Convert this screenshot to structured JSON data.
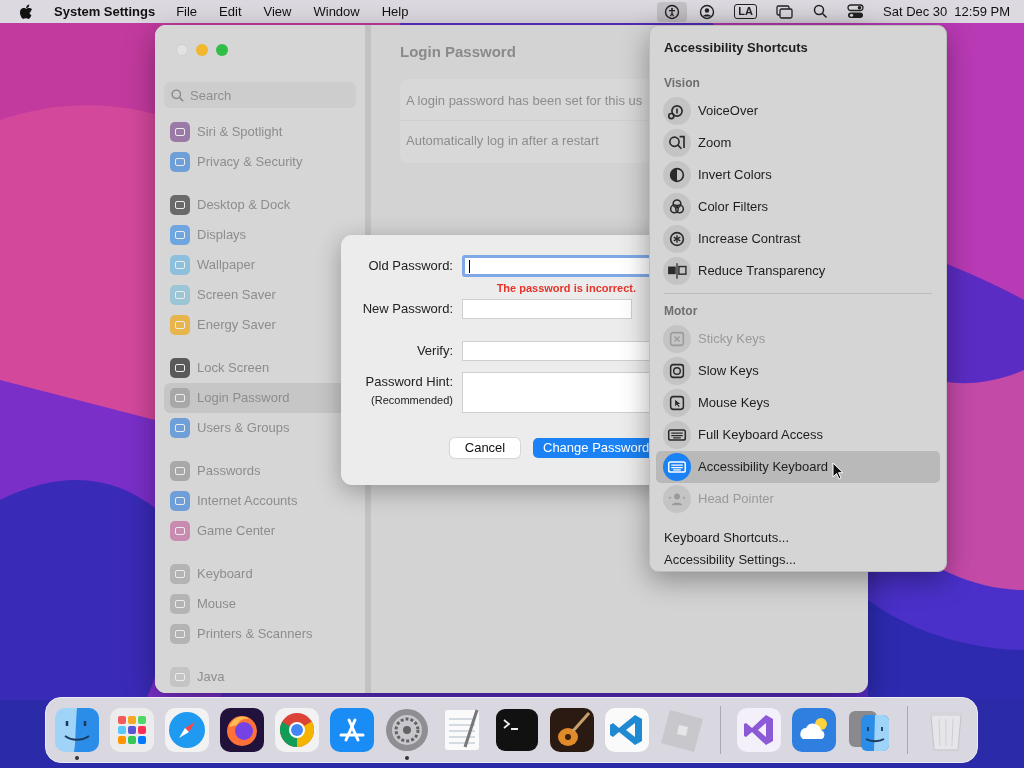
{
  "menu_bar": {
    "app_name": "System Settings",
    "menus": [
      "File",
      "Edit",
      "View",
      "Window",
      "Help"
    ],
    "status_items": [
      {
        "kind": "accessibility",
        "selected": true
      },
      {
        "kind": "user",
        "selected": false
      },
      {
        "kind": "input",
        "label": "LA",
        "selected": false
      },
      {
        "kind": "windows",
        "selected": false
      },
      {
        "kind": "search",
        "selected": false
      },
      {
        "kind": "control",
        "selected": false
      }
    ],
    "date": "Sat Dec 30",
    "time": "12:59 PM"
  },
  "settings_window": {
    "search": {
      "placeholder": "Search"
    },
    "sidebar_groups": [
      [
        {
          "label": "Siri & Spotlight",
          "color": "#9c7aa8",
          "selected": false
        },
        {
          "label": "Privacy & Security",
          "color": "#6f9fd8",
          "selected": false
        }
      ],
      [
        {
          "label": "Desktop & Dock",
          "color": "#6a6a6a",
          "selected": false
        },
        {
          "label": "Displays",
          "color": "#6fa6e0",
          "selected": false
        },
        {
          "label": "Wallpaper",
          "color": "#8dc0dc",
          "selected": false
        },
        {
          "label": "Screen Saver",
          "color": "#9cc6d6",
          "selected": false
        },
        {
          "label": "Energy Saver",
          "color": "#e8b44c",
          "selected": false
        }
      ],
      [
        {
          "label": "Lock Screen",
          "color": "#5a5a5a",
          "selected": false
        },
        {
          "label": "Login Password",
          "color": "#a8a8a8",
          "selected": true
        },
        {
          "label": "Users & Groups",
          "color": "#6f9fd8",
          "selected": false
        }
      ],
      [
        {
          "label": "Passwords",
          "color": "#a8a8a8",
          "selected": false
        },
        {
          "label": "Internet Accounts",
          "color": "#6f9fd8",
          "selected": false
        },
        {
          "label": "Game Center",
          "color": "#c98bb0",
          "selected": false
        }
      ],
      [
        {
          "label": "Keyboard",
          "color": "#b4b4b4",
          "selected": false
        },
        {
          "label": "Mouse",
          "color": "#b4b4b4",
          "selected": false
        },
        {
          "label": "Printers & Scanners",
          "color": "#b4b4b4",
          "selected": false
        }
      ],
      [
        {
          "label": "Java",
          "color": "#c4c4c4",
          "selected": false
        }
      ]
    ],
    "title": "Login Password",
    "rows": [
      "A login password has been set for this us",
      "Automatically log in after a restart"
    ]
  },
  "dialog": {
    "fields": [
      {
        "label": "Old Password:",
        "kind": "focused",
        "error": "The password is incorrect."
      },
      {
        "label": "New Password:",
        "kind": "short"
      },
      {
        "label": "Verify:",
        "kind": "normal"
      },
      {
        "label": "Password Hint:",
        "sublabel": "(Recommended)",
        "kind": "tall"
      }
    ],
    "buttons": [
      {
        "label": "Cancel",
        "kind": "secondary"
      },
      {
        "label": "Change Password",
        "kind": "primary"
      }
    ]
  },
  "accessibility_menu": {
    "title": "Accessibility Shortcuts",
    "sections": [
      {
        "heading": "Vision",
        "items": [
          {
            "label": "VoiceOver",
            "kind": "voiceover",
            "disabled": false,
            "selected": false
          },
          {
            "label": "Zoom",
            "kind": "zoom",
            "disabled": false,
            "selected": false
          },
          {
            "label": "Invert Colors",
            "kind": "invert",
            "disabled": false,
            "selected": false
          },
          {
            "label": "Color Filters",
            "kind": "filters",
            "disabled": false,
            "selected": false
          },
          {
            "label": "Increase Contrast",
            "kind": "contrast",
            "disabled": false,
            "selected": false
          },
          {
            "label": "Reduce Transparency",
            "kind": "transparency",
            "disabled": false,
            "selected": false
          }
        ]
      },
      {
        "heading": "Motor",
        "items": [
          {
            "label": "Sticky Keys",
            "kind": "sticky",
            "disabled": true,
            "selected": false
          },
          {
            "label": "Slow Keys",
            "kind": "slow",
            "disabled": false,
            "selected": false
          },
          {
            "label": "Mouse Keys",
            "kind": "mouse",
            "disabled": false,
            "selected": false
          },
          {
            "label": "Full Keyboard Access",
            "kind": "keyboard",
            "disabled": false,
            "selected": false
          },
          {
            "label": "Accessibility Keyboard",
            "kind": "keyboard",
            "disabled": false,
            "selected": true
          },
          {
            "label": "Head Pointer",
            "kind": "head",
            "disabled": true,
            "selected": false
          }
        ]
      }
    ],
    "links": [
      "Keyboard Shortcuts...",
      "Accessibility Settings..."
    ]
  },
  "dock": {
    "items": [
      {
        "kind": "finder",
        "running": true
      },
      {
        "kind": "launchpad",
        "running": false
      },
      {
        "kind": "safari",
        "running": false
      },
      {
        "kind": "firefox",
        "running": false
      },
      {
        "kind": "chrome",
        "running": false
      },
      {
        "kind": "appstore",
        "running": false
      },
      {
        "kind": "settings",
        "running": true
      },
      {
        "kind": "textedit",
        "running": false
      },
      {
        "kind": "terminal",
        "running": false
      },
      {
        "kind": "guitar",
        "running": false
      },
      {
        "kind": "vscode",
        "running": false
      },
      {
        "kind": "cube",
        "running": false
      },
      {
        "kind": "separator"
      },
      {
        "kind": "vstudio",
        "running": false
      },
      {
        "kind": "weather",
        "running": false
      },
      {
        "kind": "migration",
        "running": false
      },
      {
        "kind": "separator"
      },
      {
        "kind": "trash",
        "running": false
      }
    ]
  }
}
